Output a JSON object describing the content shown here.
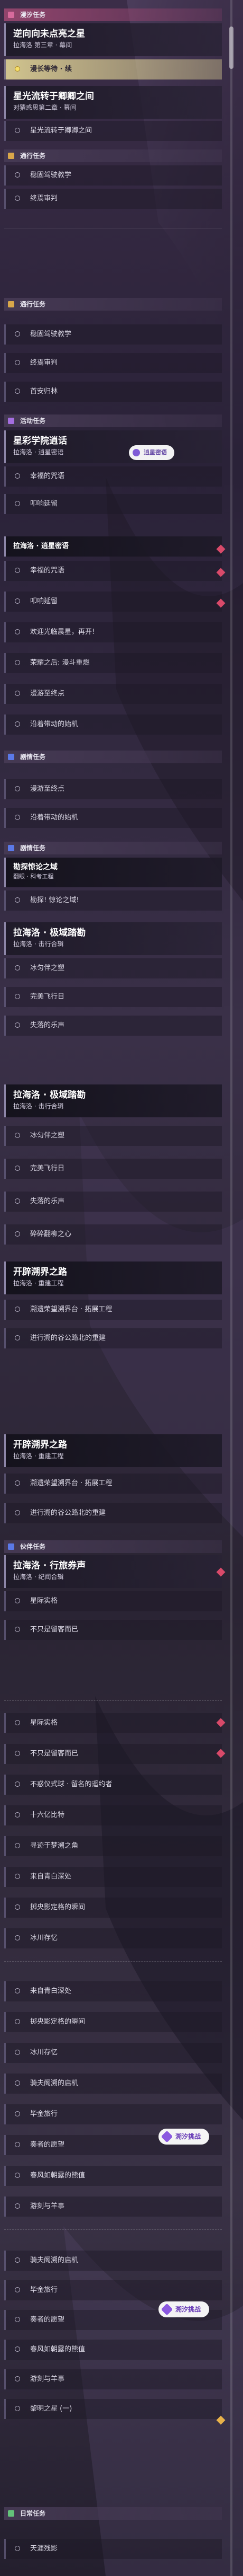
{
  "categories": {
    "trial": "漫汐任务",
    "common": "通行任务",
    "activity": "活动任务",
    "chapter": "剧情任务",
    "companion": "伙伴任务",
    "daily": "日常任务"
  },
  "quests": {
    "q1_title": "逆向向未点亮之星",
    "q1_sub": "拉海洛 第三章 · 幕间",
    "q1_step": "漫长等待 · 续",
    "q2_title": "星光流转于卿卿之间",
    "q2_sub": "对猜惑思第二章 · 幕间",
    "q2_step": "星光流转于卿卿之间",
    "c1_s1": "稳固驾驶教学",
    "c1_s2": "终焉审判",
    "c2_s1": "稳固驾驶教学",
    "c2_s2": "终焉审判",
    "c2_s3": "首安归林",
    "a1_title": "星彩学院逍话",
    "a1_sub": "拉海洛 · 逍星密语",
    "a1_badge": "逍星密语",
    "a1_s1": "幸福的咒语",
    "a1_s2": "叩响延留",
    "a2_title": "拉海洛 · 逍星密语",
    "a2_s1": "幸福的咒语",
    "a2_s2": "叩响延留",
    "a2_s3": "欢迎光临晨星，再开!",
    "a2_s4": "荣耀之后: 漫斗重燃",
    "a2_s5": "漫游至终点",
    "a2_s6": "沿着带动的始机",
    "b1_s1": "漫游至终点",
    "b1_s2": "沿着带动的始机",
    "h1_title": "勘探惊论之域",
    "h1_sub": "翻眼 · 科考工程",
    "h1_step": "勘探! 惊论之域!",
    "h2_title": "拉海洛 · 极域踏勘",
    "h2_sub": "拉海洛 · 击行合辑",
    "h2_s1": "冰匀伴之塑",
    "h2_s2": "完美飞行日",
    "h2_s3": "失落的乐声",
    "h3_title": "拉海洛 · 极域踏勘",
    "h3_sub": "拉海洛 · 击行合辑",
    "h3_s1": "冰匀伴之塑",
    "h3_s2": "完美飞行日",
    "h3_s3": "失落的乐声",
    "h3_s4": "碎碎翻柳之心",
    "k1_title": "开辟溯界之路",
    "k1_sub": "拉海洛 · 重建工程",
    "k1_s1": "溯遗荣望溯界台 · 拓展工程",
    "k1_s2": "进行溯的谷公路北的重建",
    "k2_title": "开辟溯界之路",
    "k2_sub": "拉海洛 · 重建工程",
    "k2_s1": "溯遗荣望溯界台 · 拓展工程",
    "k2_s2": "进行溯的谷公路北的重建",
    "p1_title": "拉海洛 · 行旅券声",
    "p1_sub": "拉海洛 · 纪闻合辑",
    "p1_s1": "星际实格",
    "p1_s2": "不只是留客而已",
    "p2_s1": "星际实格",
    "p2_s2": "不只是留客而已",
    "p2_s3": "不惑仪式球 · 留名的遥约者",
    "p2_s4": "十六亿比特",
    "p2_s5": "寻迹于梦溯之角",
    "p2_s6": "来自青白深处",
    "p2_s7": "掷央影定格的瞬间",
    "p2_s8": "冰川存忆",
    "p3_s1": "来自青白深处",
    "p3_s2": "掷央影定格的瞬间",
    "p3_s3": "冰川存忆",
    "p3_s4": "骑夫阁溯的启机",
    "p3_s5": "毕金旅行",
    "p3_s6": "奏者的愿望",
    "p3_badge": "溯汐挑战",
    "p3_s7": "春风如朝露的熊值",
    "p3_s8": "游刻与羊事",
    "p4_s1": "骑夫阁溯的启机",
    "p4_s2": "毕金旅行",
    "p4_s3": "奏者的愿望",
    "p4_badge": "溯汐挑战",
    "p4_s4": "春风如朝露的熊值",
    "p4_s5": "游刻与羊事",
    "p4_s6": "黎明之星 (一)",
    "d1_step": "天涯残影"
  },
  "colors": {
    "accent_yellow": "#f5df6a",
    "alert_red": "#d94a6a",
    "badge_purple": "#7f5ad6"
  }
}
